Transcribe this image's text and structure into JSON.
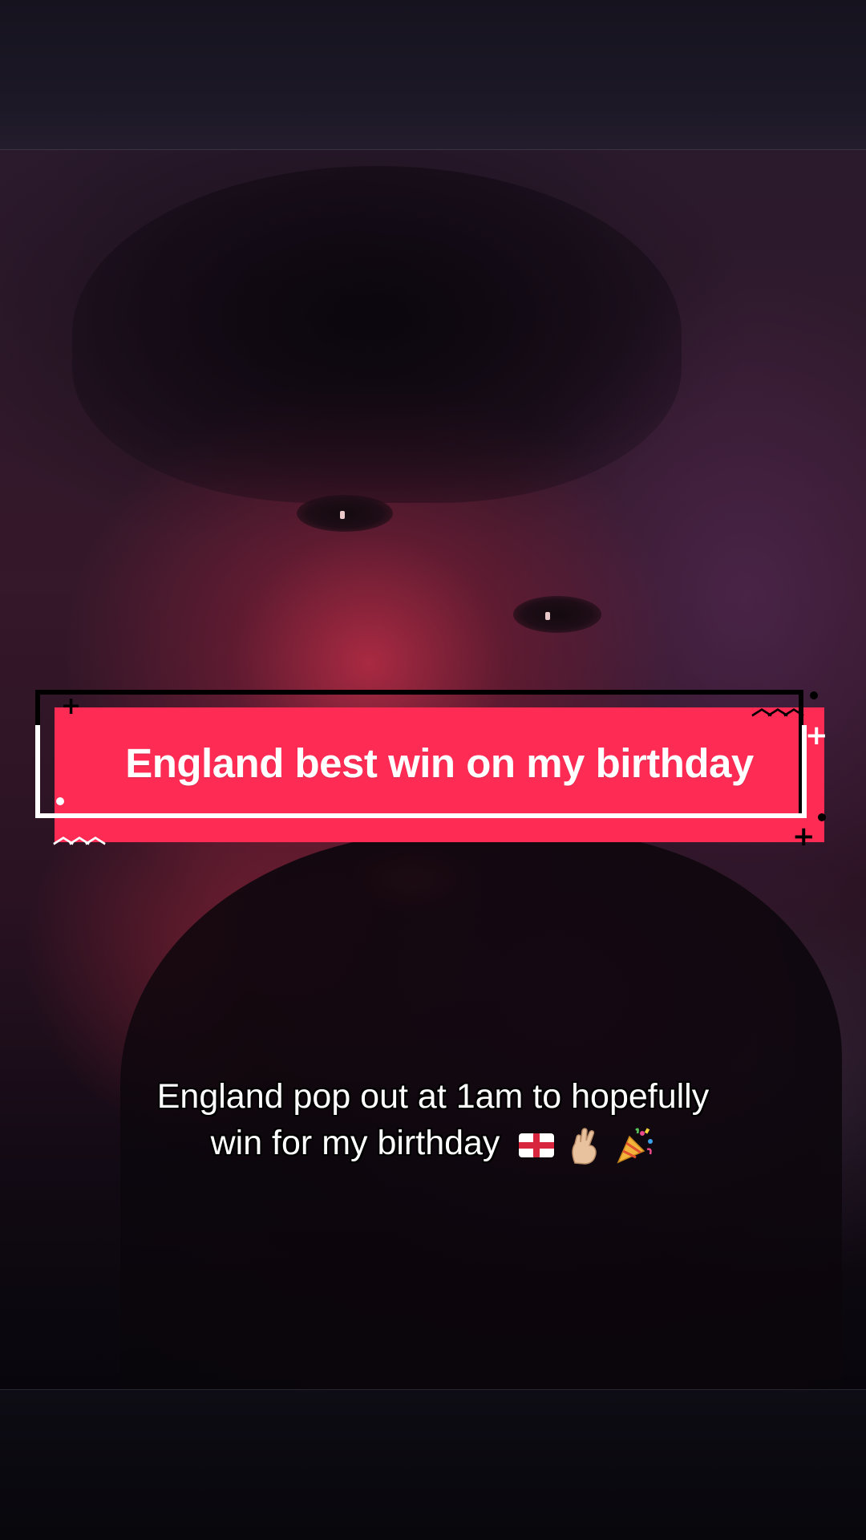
{
  "banner": {
    "title": "England best win on my birthday",
    "accent_color": "#fe2c55"
  },
  "caption": {
    "line1": "England pop out at 1am to hopefully",
    "line2": "win for my birthday",
    "emojis": [
      "england-flag-icon",
      "crossed-fingers-icon",
      "party-popper-icon"
    ]
  }
}
